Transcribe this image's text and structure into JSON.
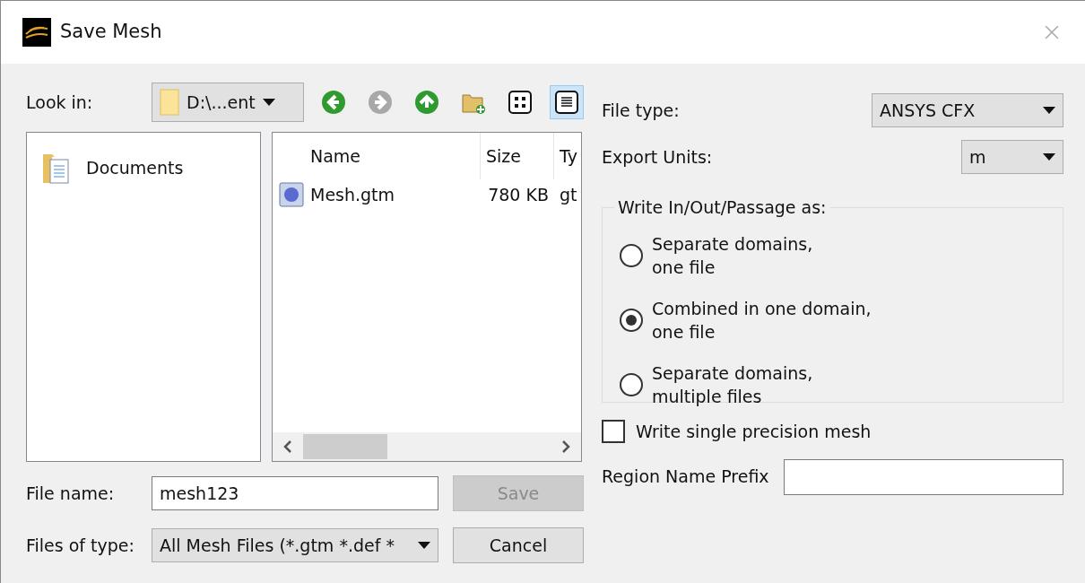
{
  "window": {
    "title": "Save Mesh"
  },
  "look_in": {
    "label": "Look in:",
    "value": "D:\\...ent"
  },
  "toolbar": {
    "nav_buttons": [
      {
        "kind": "back",
        "disabled": false
      },
      {
        "kind": "forward",
        "disabled": true
      },
      {
        "kind": "up",
        "disabled": false
      },
      {
        "kind": "new_folder",
        "disabled": false
      }
    ],
    "view_buttons": [
      {
        "kind": "icons",
        "selected": false
      },
      {
        "kind": "details",
        "selected": true
      }
    ]
  },
  "sidebar": {
    "items": [
      {
        "label": "Documents"
      }
    ]
  },
  "file_list": {
    "columns": [
      "Name",
      "Size",
      "Ty"
    ],
    "rows": [
      {
        "name": "Mesh.gtm",
        "size": "780 KB",
        "type": "gt"
      }
    ]
  },
  "file_name": {
    "label": "File name:",
    "value": "mesh123"
  },
  "files_of_type": {
    "label": "Files of type:",
    "value": "All Mesh Files (*.gtm *.def *"
  },
  "buttons": [
    {
      "label": "Save",
      "disabled": true
    },
    {
      "label": "Cancel",
      "disabled": false
    }
  ],
  "file_type": {
    "label": "File type:",
    "value": "ANSYS CFX"
  },
  "export_units": {
    "label": "Export Units:",
    "value": "m"
  },
  "write_as": {
    "title": "Write In/Out/Passage as:",
    "options": [
      {
        "label": "Separate domains,\none file",
        "selected": false
      },
      {
        "label": "Combined in one domain,\none file",
        "selected": true
      },
      {
        "label": "Separate domains,\nmultiple files",
        "selected": false
      }
    ]
  },
  "single_precision": {
    "label": "Write single precision mesh",
    "checked": false
  },
  "region_prefix": {
    "label": "Region Name Prefix"
  }
}
